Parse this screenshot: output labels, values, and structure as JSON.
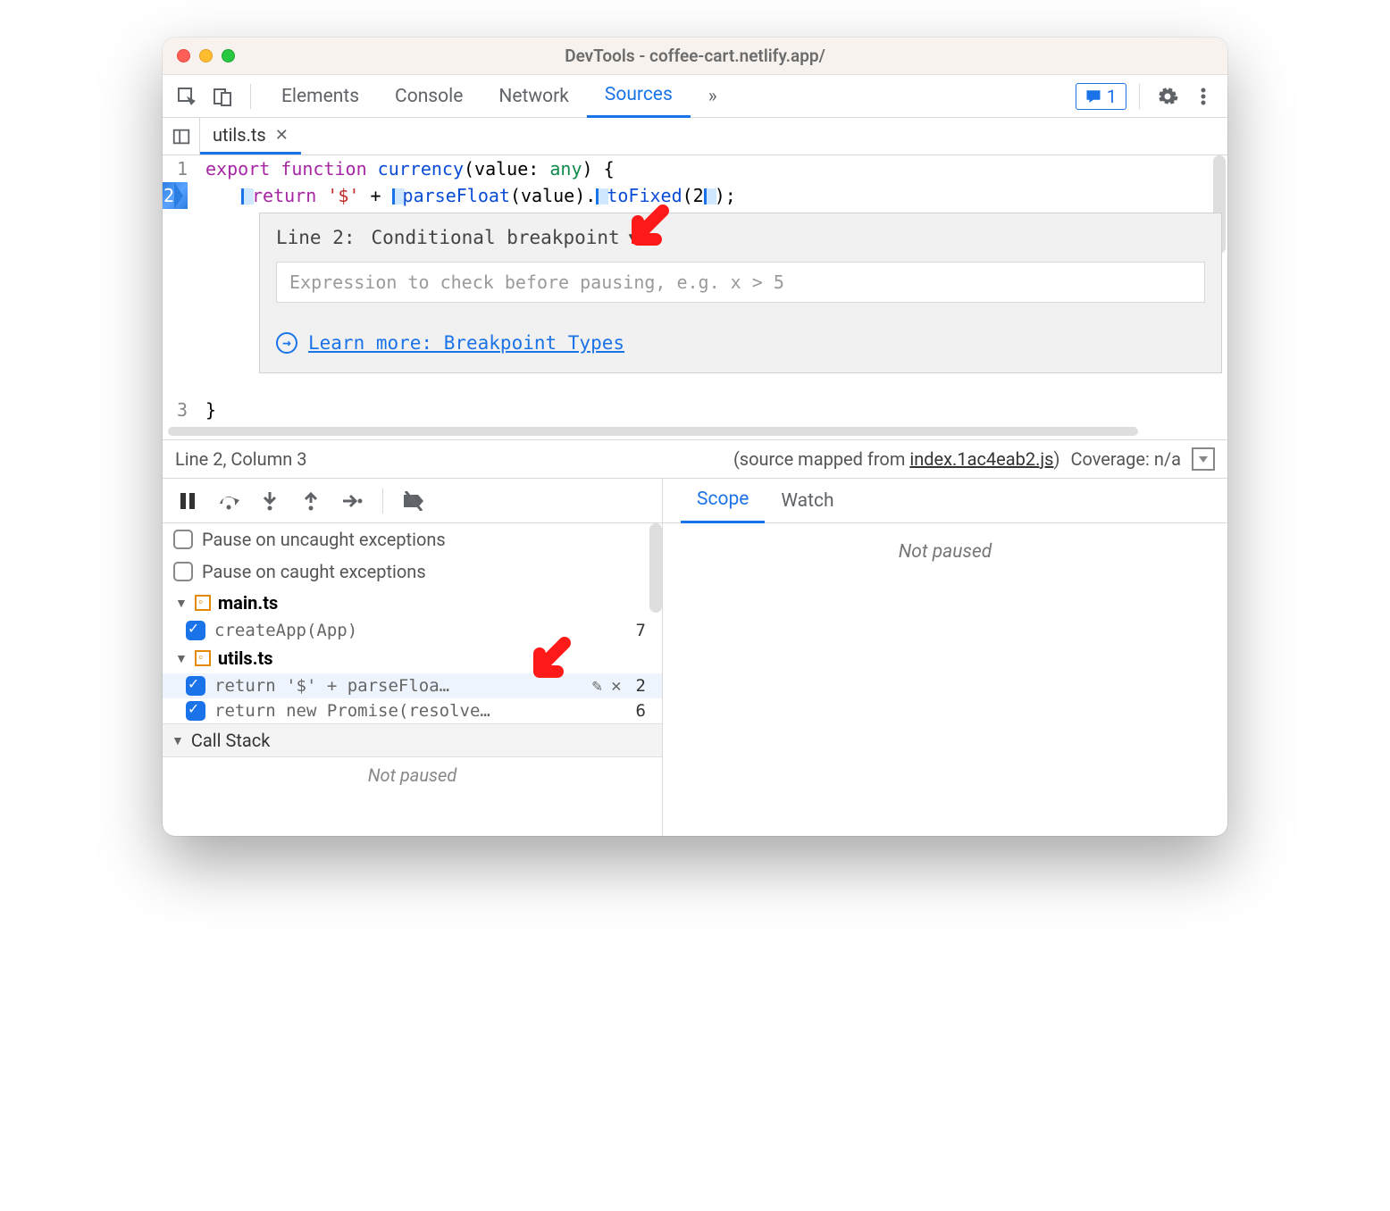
{
  "window": {
    "title": "DevTools - coffee-cart.netlify.app/"
  },
  "toolbar": {
    "tabs": [
      "Elements",
      "Console",
      "Network",
      "Sources"
    ],
    "activeTab": "Sources",
    "moreGlyph": "»",
    "messageCount": "1"
  },
  "file": {
    "name": "utils.ts"
  },
  "code": {
    "line1": {
      "kw_export": "export",
      "kw_function": "function",
      "fn": "currency",
      "lparen": "(",
      "param": "value",
      "colon": ": ",
      "type": "any",
      "rparen": ") {"
    },
    "line2": {
      "kw_return": "return",
      "str": "'$'",
      "plus": " + ",
      "call1": "parseFloat",
      "lp": "(",
      "arg": "value",
      "rp": ").",
      "call2": "toFixed",
      "lp2": "(",
      "two": "2",
      "rp2": ");"
    },
    "line3": "}"
  },
  "gutter": {
    "l1": "1",
    "l2": "2",
    "l3": "3"
  },
  "dialog": {
    "linePrefix": "Line 2:",
    "type": "Conditional breakpoint",
    "placeholder": "Expression to check before pausing, e.g. x > 5",
    "learn": "Learn more: Breakpoint Types"
  },
  "status": {
    "left": "Line 2, Column 3",
    "mappedPrefix": "(source mapped from ",
    "mappedFile": "index.1ac4eab2.js",
    "mappedSuffix": ")",
    "coverage": "Coverage: n/a"
  },
  "leftPane": {
    "pauseUncaught": "Pause on uncaught exceptions",
    "pauseCaught": "Pause on caught exceptions",
    "files": [
      {
        "name": "main.ts",
        "items": [
          {
            "label": "createApp(App)",
            "line": "7",
            "hover": false
          }
        ]
      },
      {
        "name": "utils.ts",
        "items": [
          {
            "label": "return '$' + parseFloa…",
            "line": "2",
            "hover": true
          },
          {
            "label": "return new Promise(resolve…",
            "line": "6",
            "hover": false
          }
        ]
      }
    ],
    "callStack": "Call Stack",
    "notPaused": "Not paused"
  },
  "rightPane": {
    "tabs": [
      "Scope",
      "Watch"
    ],
    "active": "Scope",
    "notPaused": "Not paused"
  }
}
